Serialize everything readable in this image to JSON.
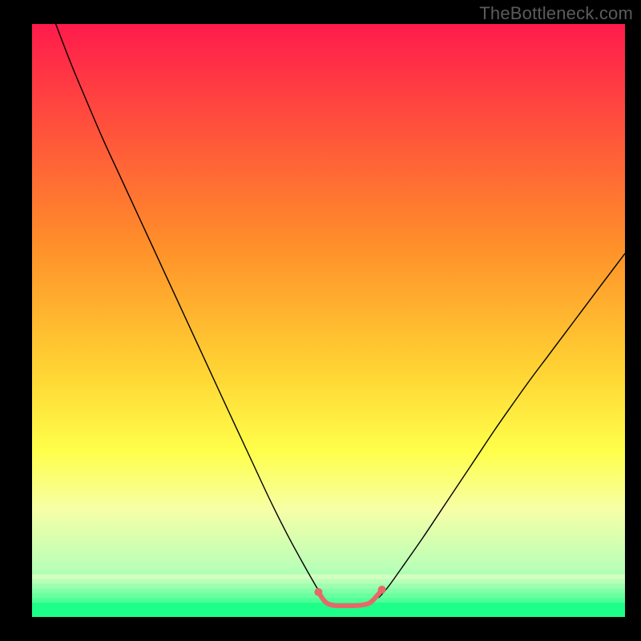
{
  "watermark": "TheBottleneck.com",
  "chart_data": {
    "type": "line",
    "title": "",
    "xlabel": "",
    "ylabel": "",
    "xlim": [
      0,
      100
    ],
    "ylim": [
      0,
      100
    ],
    "grid": false,
    "legend": false,
    "background_gradient_stops": [
      {
        "pos": 0,
        "color": "#ff1b4c"
      },
      {
        "pos": 37,
        "color": "#ff8e2a"
      },
      {
        "pos": 58,
        "color": "#ffd233"
      },
      {
        "pos": 72,
        "color": "#ffff4a"
      },
      {
        "pos": 82,
        "color": "#f6ffa7"
      },
      {
        "pos": 92,
        "color": "#b8ffb8"
      },
      {
        "pos": 100,
        "color": "#1dff88"
      }
    ],
    "green_bands": [
      {
        "y0": 92.8,
        "y1": 93.6,
        "color": "#d4ffc0"
      },
      {
        "y0": 93.6,
        "y1": 94.4,
        "color": "#b8ffb8"
      },
      {
        "y0": 94.4,
        "y1": 95.2,
        "color": "#9cffb0"
      },
      {
        "y0": 95.2,
        "y1": 96.0,
        "color": "#82ffa8"
      },
      {
        "y0": 96.0,
        "y1": 96.8,
        "color": "#68ffa0"
      },
      {
        "y0": 96.8,
        "y1": 97.6,
        "color": "#4eff98"
      },
      {
        "y0": 97.6,
        "y1": 100.0,
        "color": "#1dff88"
      }
    ],
    "series": [
      {
        "name": "left-curve",
        "color": "#000000",
        "width": 1.4,
        "points": [
          {
            "x": 4.0,
            "y": 100.0
          },
          {
            "x": 6.5,
            "y": 93.5
          },
          {
            "x": 9.0,
            "y": 87.5
          },
          {
            "x": 12.0,
            "y": 80.5
          },
          {
            "x": 15.0,
            "y": 74.0
          },
          {
            "x": 18.0,
            "y": 67.5
          },
          {
            "x": 21.0,
            "y": 61.0
          },
          {
            "x": 24.0,
            "y": 54.5
          },
          {
            "x": 27.0,
            "y": 48.0
          },
          {
            "x": 30.0,
            "y": 41.5
          },
          {
            "x": 33.0,
            "y": 35.0
          },
          {
            "x": 36.5,
            "y": 27.5
          },
          {
            "x": 40.0,
            "y": 20.0
          },
          {
            "x": 43.0,
            "y": 14.0
          },
          {
            "x": 46.0,
            "y": 8.5
          },
          {
            "x": 48.0,
            "y": 5.0
          },
          {
            "x": 49.0,
            "y": 3.3
          }
        ]
      },
      {
        "name": "right-curve",
        "color": "#000000",
        "width": 1.4,
        "points": [
          {
            "x": 58.5,
            "y": 3.3
          },
          {
            "x": 60.0,
            "y": 5.0
          },
          {
            "x": 63.0,
            "y": 9.2
          },
          {
            "x": 66.0,
            "y": 13.5
          },
          {
            "x": 69.0,
            "y": 18.0
          },
          {
            "x": 72.0,
            "y": 22.5
          },
          {
            "x": 75.0,
            "y": 27.0
          },
          {
            "x": 78.0,
            "y": 31.5
          },
          {
            "x": 81.0,
            "y": 35.8
          },
          {
            "x": 84.0,
            "y": 40.0
          },
          {
            "x": 87.0,
            "y": 44.0
          },
          {
            "x": 90.0,
            "y": 48.0
          },
          {
            "x": 93.0,
            "y": 52.0
          },
          {
            "x": 96.0,
            "y": 56.0
          },
          {
            "x": 100.0,
            "y": 61.3
          }
        ]
      },
      {
        "name": "bottom-band",
        "color": "#e46a6a",
        "width": 6.0,
        "points": [
          {
            "x": 48.3,
            "y": 4.2
          },
          {
            "x": 49.4,
            "y": 2.6
          },
          {
            "x": 50.6,
            "y": 2.0
          },
          {
            "x": 52.2,
            "y": 1.9
          },
          {
            "x": 54.0,
            "y": 1.9
          },
          {
            "x": 55.6,
            "y": 2.0
          },
          {
            "x": 57.0,
            "y": 2.4
          },
          {
            "x": 58.2,
            "y": 3.6
          },
          {
            "x": 59.0,
            "y": 4.6
          }
        ]
      },
      {
        "name": "end-dot-left",
        "type": "marker",
        "color": "#e46a6a",
        "radius": 5.0,
        "point": {
          "x": 48.3,
          "y": 4.2
        }
      },
      {
        "name": "end-dot-right",
        "type": "marker",
        "color": "#e46a6a",
        "radius": 5.0,
        "point": {
          "x": 59.0,
          "y": 4.6
        }
      }
    ]
  }
}
